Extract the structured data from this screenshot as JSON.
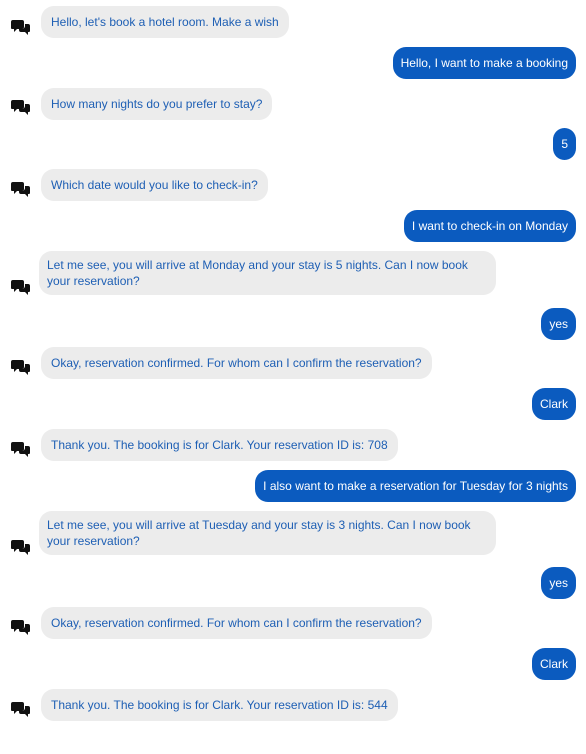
{
  "messages": [
    {
      "from": "bot",
      "text": "Hello, let's book a hotel room. Make a wish"
    },
    {
      "from": "user",
      "text": "Hello, I want to make a booking"
    },
    {
      "from": "bot",
      "text": "How many nights do you prefer to stay?"
    },
    {
      "from": "user",
      "text": "5"
    },
    {
      "from": "bot",
      "text": "Which date would you like to check-in?"
    },
    {
      "from": "user",
      "text": "I want to check-in on Monday"
    },
    {
      "from": "bot",
      "text": "Let me see, you will arrive at Monday and your stay is 5 nights. Can I now book your reservation?"
    },
    {
      "from": "user",
      "text": "yes"
    },
    {
      "from": "bot",
      "text": "Okay, reservation confirmed. For whom can I confirm the reservation?"
    },
    {
      "from": "user",
      "text": "Clark"
    },
    {
      "from": "bot",
      "text": "Thank you. The booking is for Clark. Your reservation ID is: 708"
    },
    {
      "from": "user",
      "text": "I also want to make a reservation for Tuesday for 3 nights"
    },
    {
      "from": "bot",
      "text": "Let me see, you will arrive at Tuesday and your stay is 3 nights. Can I now book your reservation?"
    },
    {
      "from": "user",
      "text": "yes"
    },
    {
      "from": "bot",
      "text": "Okay, reservation confirmed. For whom can I confirm the reservation?"
    },
    {
      "from": "user",
      "text": "Clark"
    },
    {
      "from": "bot",
      "text": "Thank you. The booking is for Clark. Your reservation ID is: 544"
    }
  ],
  "icons": {
    "bot_avatar": "chat-bubbles-icon"
  },
  "colors": {
    "bot_bubble_bg": "#ececec",
    "bot_text": "#1e5fb4",
    "user_bubble_bg": "#0b5bbf",
    "user_text": "#ffffff"
  }
}
